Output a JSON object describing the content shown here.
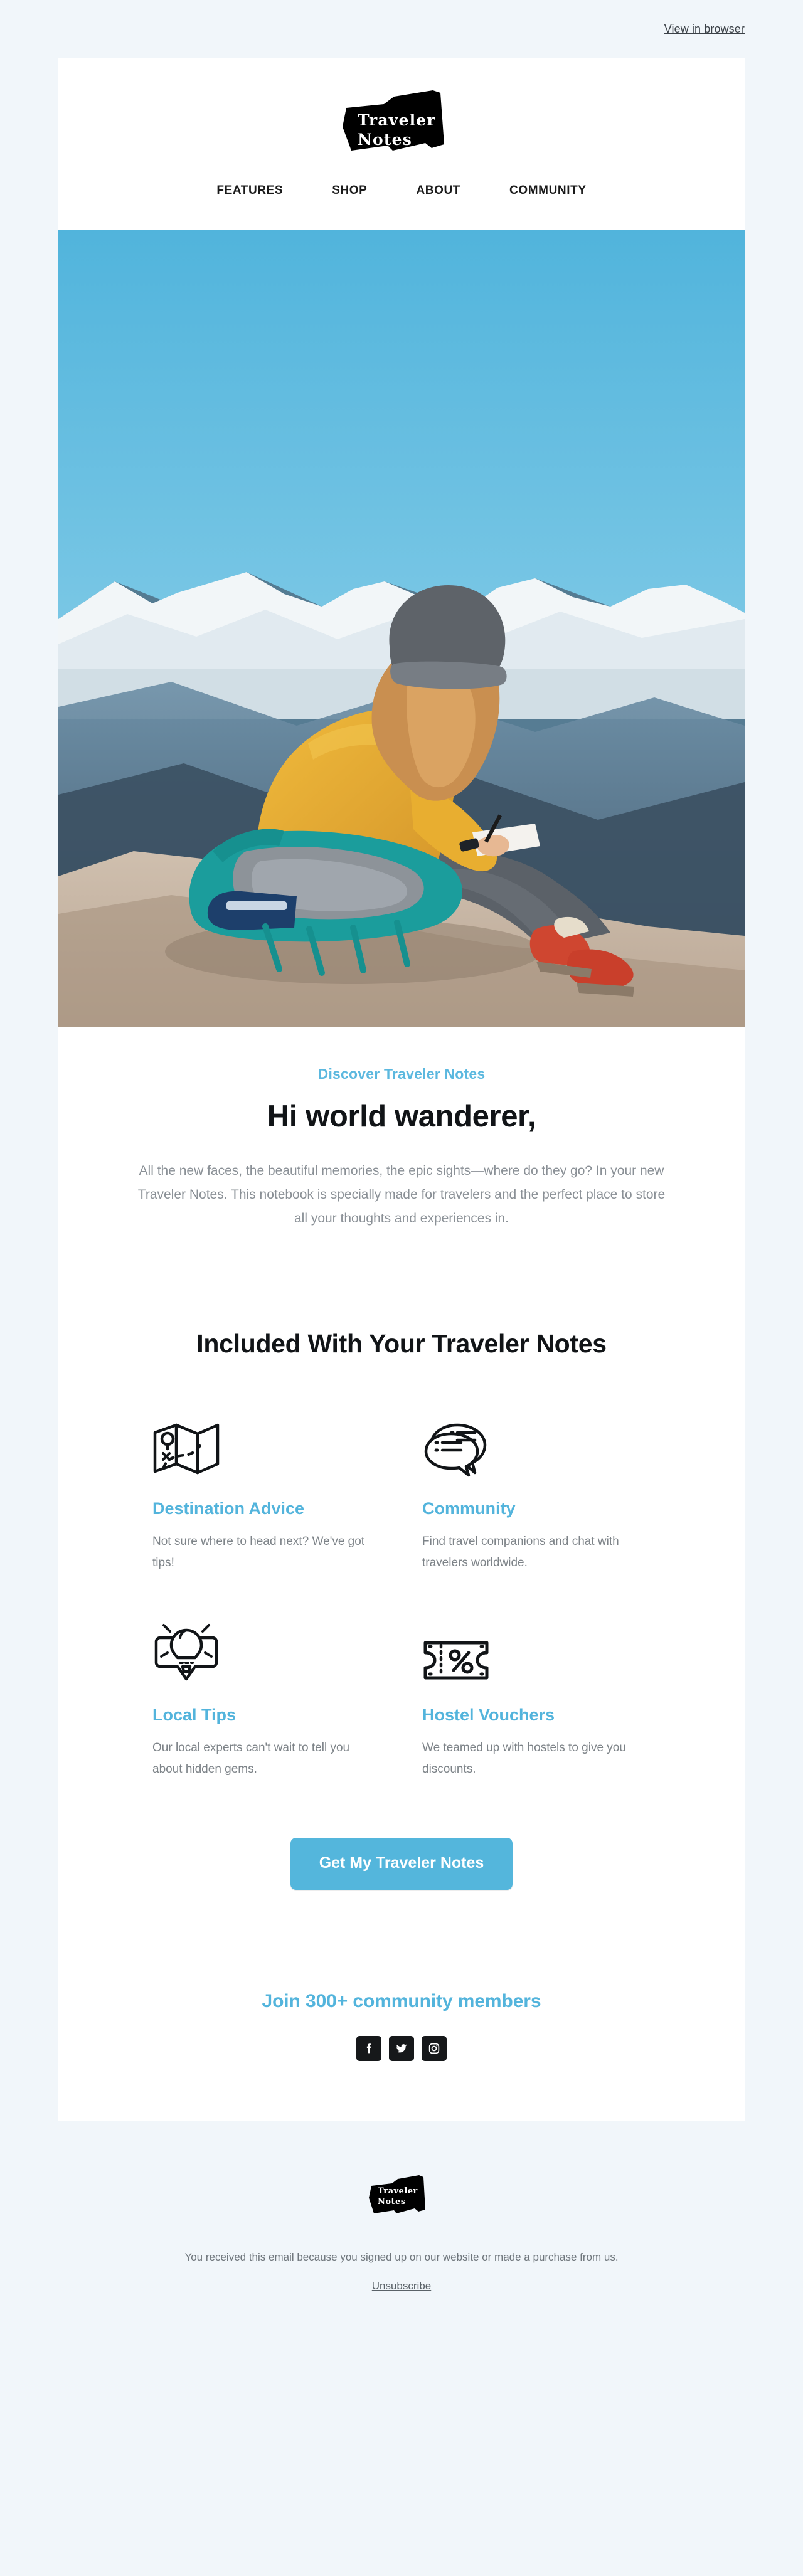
{
  "preheader": {
    "view_in_browser": "View in browser"
  },
  "brand": {
    "name_line1": "Traveler",
    "name_line2": "Notes",
    "logo_text": "Traveler\nNotes",
    "accent_color": "#53b4dc",
    "logo_bg": "#000000"
  },
  "nav": {
    "items": [
      {
        "label": "FEATURES"
      },
      {
        "label": "SHOP"
      },
      {
        "label": "ABOUT"
      },
      {
        "label": "COMMUNITY"
      }
    ]
  },
  "hero": {
    "image_alt": "Woman in yellow sweater and grey beanie sitting on a rock writing in a notebook with snowy mountains behind her",
    "sky_color": "#6cc0e2",
    "sweater_color": "#e8a92c",
    "backpack_color": "#1f9d9a",
    "boot_color": "#d2462f"
  },
  "intro": {
    "eyebrow": "Discover Traveler Notes",
    "heading": "Hi world wanderer,",
    "body": "All the new faces, the beautiful memories, the epic sights—where do they go? In your new Traveler Notes. This notebook is specially made for travelers and the perfect place to store all your thoughts and experiences in."
  },
  "features": {
    "heading": "Included With Your Traveler Notes",
    "items": [
      {
        "icon": "map-icon",
        "title": "Destination Advice",
        "body": "Not sure where to head next? We've got tips!"
      },
      {
        "icon": "chat-bubbles-icon",
        "title": "Community",
        "body": "Find travel companions and chat with travelers worldwide."
      },
      {
        "icon": "lightbulb-pin-icon",
        "title": "Local Tips",
        "body": "Our local experts can't wait to tell you about hidden gems."
      },
      {
        "icon": "ticket-percent-icon",
        "title": "Hostel Vouchers",
        "body": "We teamed up with hostels to give you discounts."
      }
    ]
  },
  "cta": {
    "label": "Get My Traveler Notes",
    "color": "#54b6dc"
  },
  "social": {
    "heading": "Join 300+ community members",
    "icons": [
      {
        "name": "facebook-icon"
      },
      {
        "name": "twitter-icon"
      },
      {
        "name": "instagram-icon"
      }
    ]
  },
  "footer": {
    "logo_text": "Traveler\nNotes",
    "disclaimer": "You received this email because you signed up on our website or made a purchase from us.",
    "unsubscribe": "Unsubscribe"
  }
}
